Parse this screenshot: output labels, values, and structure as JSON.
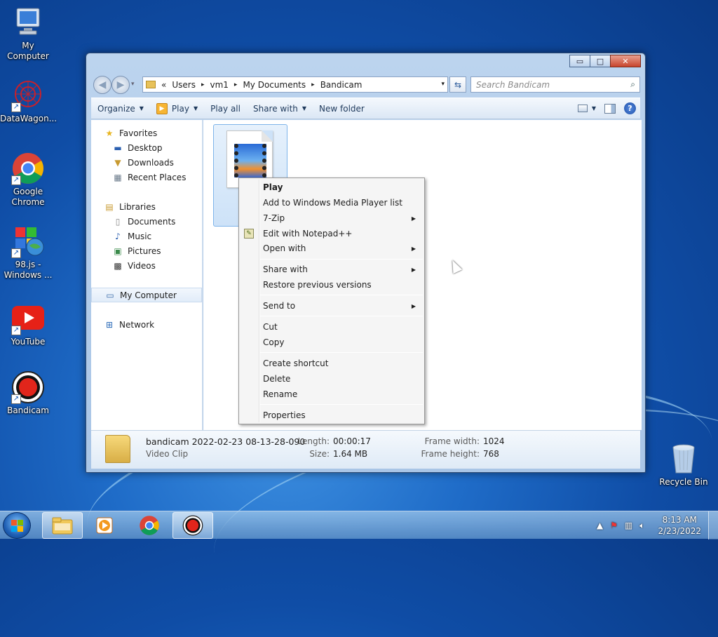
{
  "desktop": {
    "icons": [
      {
        "label": "My Computer",
        "icon": "computer-icon"
      },
      {
        "label": "DataWagon...",
        "icon": "datawagon-icon"
      },
      {
        "label": "Google Chrome",
        "icon": "chrome-icon"
      },
      {
        "label": "98.js - Windows ...",
        "icon": "windows98-icon"
      },
      {
        "label": "YouTube",
        "icon": "youtube-icon"
      },
      {
        "label": "Bandicam",
        "icon": "bandicam-icon"
      },
      {
        "label": "Recycle Bin",
        "icon": "recycle-bin-icon"
      }
    ]
  },
  "window": {
    "controls": {
      "minimize": "▭",
      "maximize": "□",
      "close": "✕"
    },
    "address": {
      "overflow": "«",
      "crumbs": [
        "Users",
        "vm1",
        "My Documents",
        "Bandicam"
      ],
      "separator": "▸",
      "dropdown": "▾"
    },
    "search_placeholder": "Search Bandicam",
    "toolbar": {
      "organize": "Organize",
      "play": "Play",
      "play_all": "Play all",
      "share_with": "Share with",
      "new_folder": "New folder"
    },
    "nav": {
      "favorites": "Favorites",
      "favorites_items": [
        "Desktop",
        "Downloads",
        "Recent Places"
      ],
      "libraries": "Libraries",
      "libraries_items": [
        "Documents",
        "Music",
        "Pictures",
        "Videos"
      ],
      "my_computer": "My Computer",
      "network": "Network"
    },
    "file": {
      "label_lines": [
        "ba",
        "20",
        "08-"
      ]
    },
    "details": {
      "name": "bandicam 2022-02-23 08-13-28-090",
      "type": "Video Clip",
      "length_label": "Length:",
      "length_value": "00:00:17",
      "size_label": "Size:",
      "size_value": "1.64 MB",
      "frame_width_label": "Frame width:",
      "frame_width_value": "1024",
      "frame_height_label": "Frame height:",
      "frame_height_value": "768"
    }
  },
  "context_menu": {
    "play": "Play",
    "add_wmp": "Add to Windows Media Player list",
    "seven_zip": "7-Zip",
    "edit_npp": "Edit with Notepad++",
    "open_with": "Open with",
    "share_with": "Share with",
    "restore": "Restore previous versions",
    "send_to": "Send to",
    "cut": "Cut",
    "copy": "Copy",
    "create_shortcut": "Create shortcut",
    "delete": "Delete",
    "rename": "Rename",
    "properties": "Properties",
    "submenu_arrow": "▶"
  },
  "taskbar": {
    "clock_time": "8:13 AM",
    "clock_date": "2/23/2022",
    "tray_up": "▲"
  },
  "colors": {
    "accent": "#1f6cc8",
    "selection": "#cde2f8"
  }
}
